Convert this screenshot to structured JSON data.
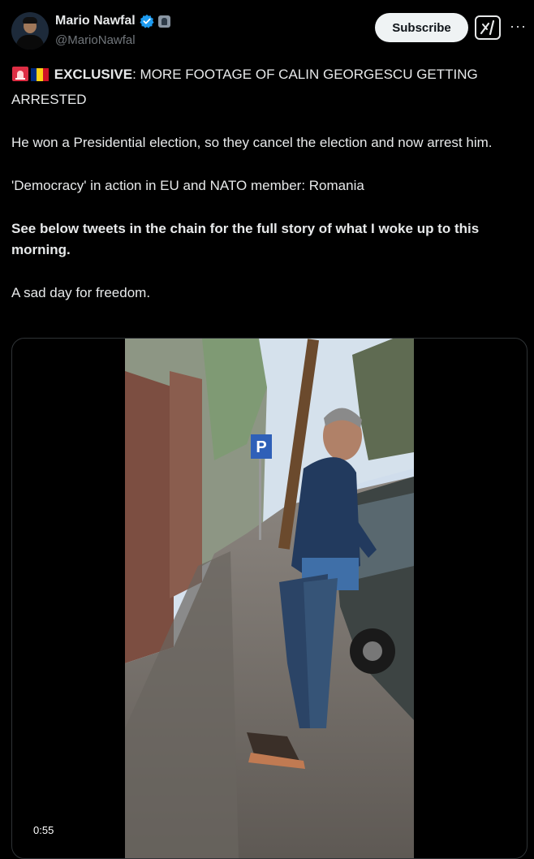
{
  "author": {
    "name": "Mario Nawfal",
    "handle": "@MarioNawfal",
    "avatar_icon": "profile-photo",
    "verified_color": "#1d9bf0"
  },
  "actions": {
    "subscribe_label": "Subscribe",
    "grok_icon": "grok-icon",
    "more_icon": "more-options-icon"
  },
  "tweet": {
    "emoji": [
      "🚨",
      "🇷🇴"
    ],
    "headline_bold": "EXCLUSIVE",
    "headline_rest": ": MORE FOOTAGE OF CALIN GEORGESCU GETTING ARRESTED",
    "para2": "He won a Presidential election, so they cancel the election and now arrest him.",
    "para3": "'Democracy' in action in EU and NATO member: Romania",
    "para4": "See below tweets in the chain for the full story of what I woke up to this morning.",
    "para5": "A sad day for freedom."
  },
  "media": {
    "type": "video",
    "timestamp": "0:55",
    "sign_text": "P"
  },
  "colors": {
    "background": "#000000",
    "text": "#e7e9ea",
    "secondary": "#71767b",
    "border": "#2f3336"
  }
}
